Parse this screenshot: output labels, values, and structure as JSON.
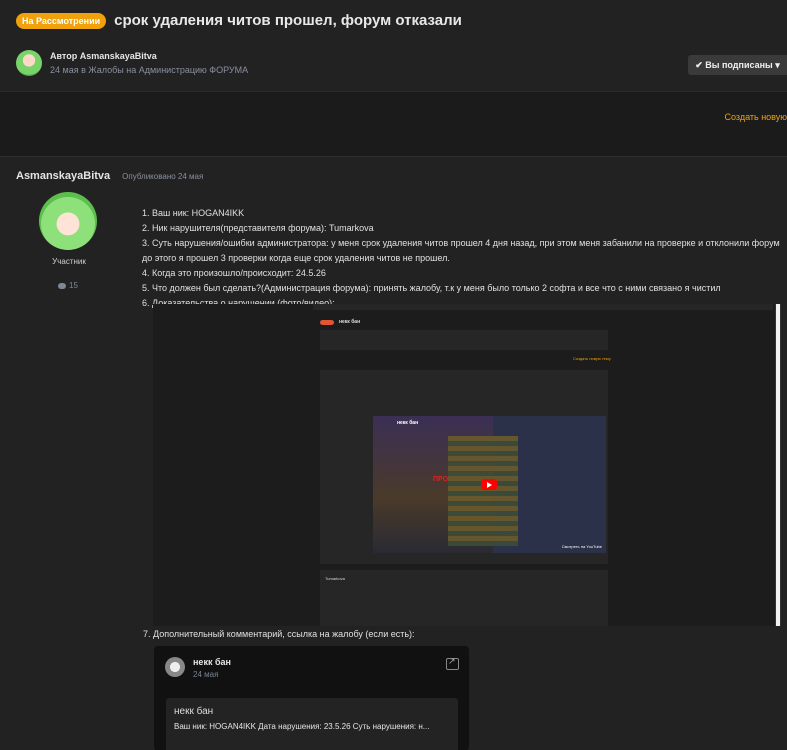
{
  "topic": {
    "status_badge": "На Рассмотрении",
    "title": "срок удаления читов прошел, форум отказали",
    "author_line": "Автор AsmanskayaBitva",
    "meta_line": "24 мая в Жалобы на Администрацию ФОРУМА",
    "subscribe_label": "✔ Вы подписаны ▾",
    "create_link": "Создать новую"
  },
  "post": {
    "author": "AsmanskayaBitva",
    "published": "Опубликовано 24 мая",
    "role": "Участник",
    "reputation": "15",
    "items": [
      "1. Ваш ник: HOGAN4IKK",
      "2. Ник нарушителя(представителя форума): Tumarkova",
      "3. Суть нарушения/ошибки администратора:  у меня срок удаления читов прошел 4 дня назад, при этом меня забанили на проверке и отклонили форум",
      "до этого я прошел 3 проверки когда еще срок удаления читов не прошел.",
      "4. Когда это произошло/происходит: 24.5.26",
      "5. Что должен был сделать?(Администрация форума): принять жалобу, т.к у меня было только 2 софта и все что с ними связано я чистил",
      "6. Доказательства о нарушении (фото/видео):"
    ],
    "item7": "7. Дополнительный комментарий, ссылка на жалобу (если есть):",
    "embed": {
      "title": "некк бан",
      "video_title": "некк бан",
      "watch": "Смотреть на YouTube",
      "reply_author": "Tumarkova",
      "create_link": "Создать новую тему"
    },
    "link_card": {
      "name": "некк бан",
      "date": "24 мая",
      "inner_title": "некк бан",
      "inner_text": "Ваш ник: HOGAN4IKK Дата нарушения: 23.5.26 Суть нарушения: н..."
    }
  },
  "colors": {
    "accent": "#f0a10c",
    "background": "#1b1b1b",
    "panel": "#222222"
  }
}
